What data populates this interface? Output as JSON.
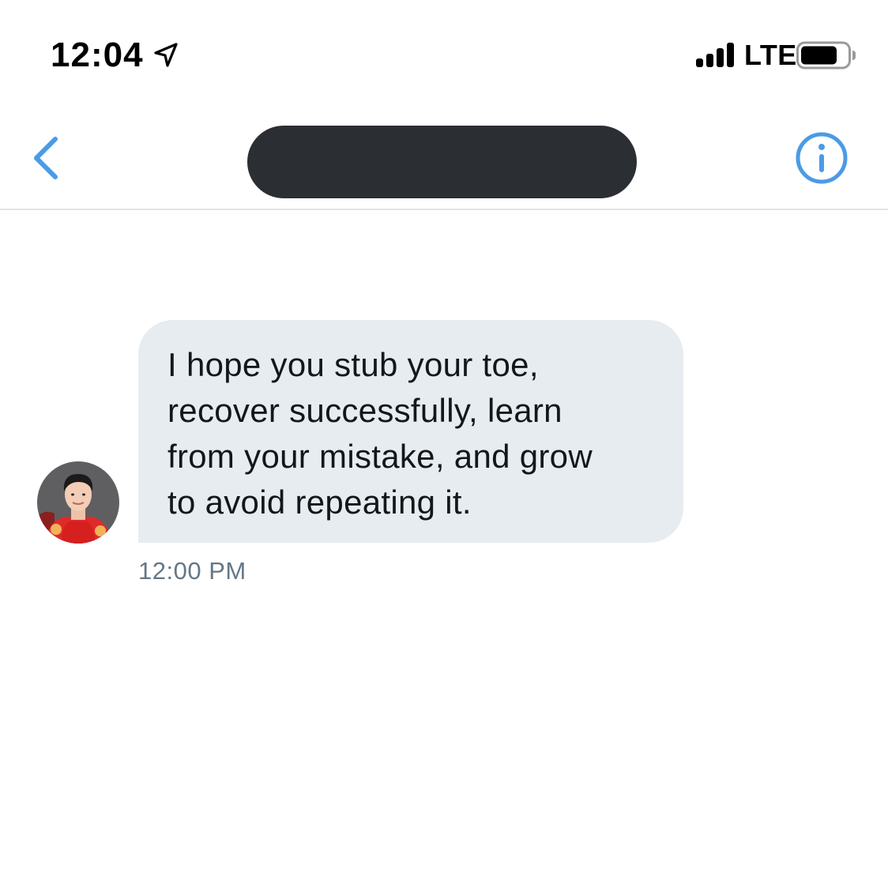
{
  "status_bar": {
    "time": "12:04",
    "network": "LTE",
    "icons": [
      "location-arrow-icon",
      "cellular-signal-icon",
      "battery-icon"
    ]
  },
  "nav_bar": {
    "back_icon": "chevron-left-icon",
    "info_icon": "info-circle-icon",
    "contact_name_redacted": true
  },
  "conversation": {
    "messages": [
      {
        "direction": "received",
        "text": "I hope you stub your toe,\nrecover successfully, learn\nfrom your mistake, and grow\nto avoid repeating it.",
        "timestamp": "12:00 PM",
        "avatar": "sender-avatar-photo"
      }
    ]
  },
  "colors": {
    "accent": "#4a9be6",
    "bubble_received": "#e6ecf0",
    "timestamp_text": "#657786",
    "redaction": "#2b2e33",
    "divider": "#e1e4e8"
  }
}
